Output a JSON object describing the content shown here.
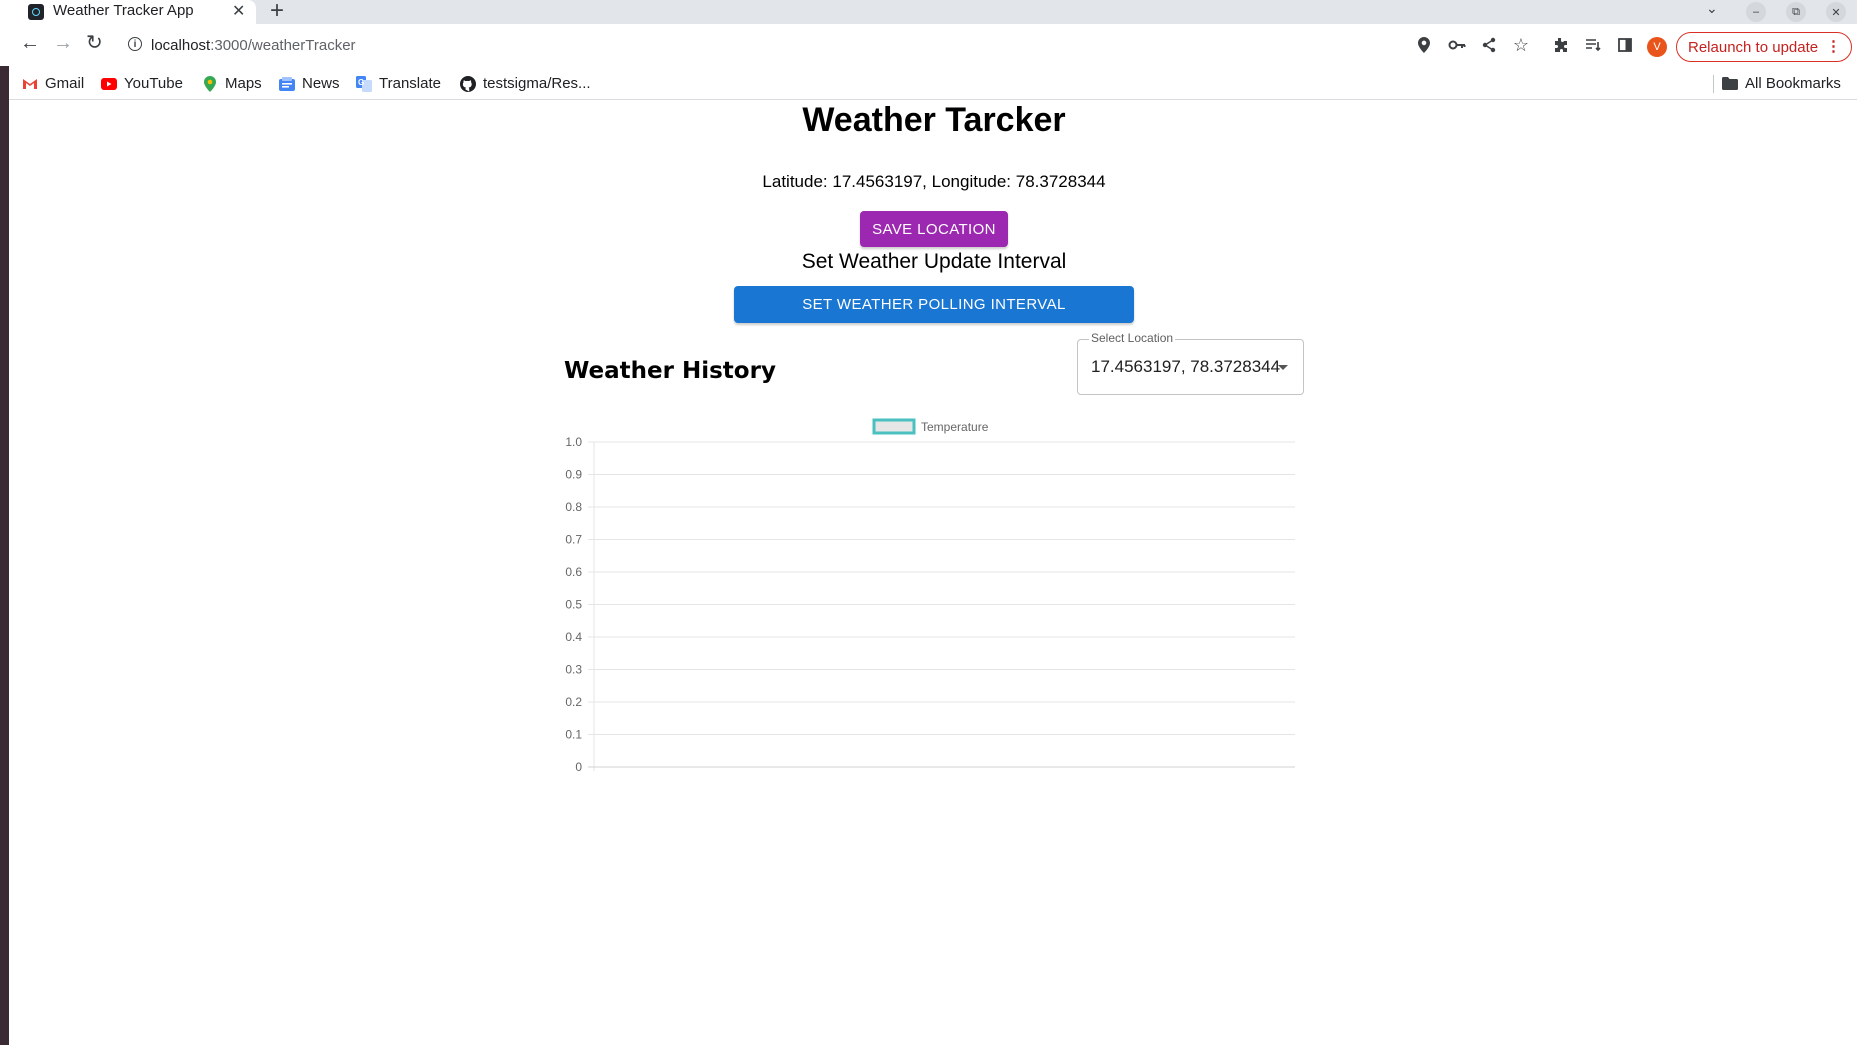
{
  "browser": {
    "tab_title": "Weather Tracker App",
    "tab_close": "✕",
    "new_tab": "+",
    "url_host": "localhost",
    "url_path": ":3000/weatherTracker",
    "avatar_letter": "V",
    "relaunch_label": "Relaunch to update",
    "bookmarks": [
      "Gmail",
      "YouTube",
      "Maps",
      "News",
      "Translate",
      "testsigma/Res..."
    ],
    "all_bookmarks": "All Bookmarks"
  },
  "page": {
    "title": "Weather Tarcker",
    "coordinates": "Latitude: 17.4563197, Longitude: 78.3728344",
    "save_location_label": "SAVE LOCATION",
    "interval_heading": "Set Weather Update Interval",
    "interval_button_label": "SET WEATHER POLLING INTERVAL",
    "history_title": "Weather History",
    "select_label": "Select Location",
    "select_value": "17.4563197, 78.3728344"
  },
  "colors": {
    "save_button": "#9c27b0",
    "interval_button": "#1976d2",
    "series_border": "#4bc0c0",
    "relaunch": "#c5221f"
  },
  "chart_data": {
    "type": "line",
    "legend": [
      "Temperature"
    ],
    "legend_position": "top",
    "series": [
      {
        "name": "Temperature",
        "values": []
      }
    ],
    "x": [],
    "ylim": [
      0,
      1
    ],
    "yticks": [
      "1.0",
      "0.9",
      "0.8",
      "0.7",
      "0.6",
      "0.5",
      "0.4",
      "0.3",
      "0.2",
      "0.1",
      "0"
    ],
    "grid": true
  }
}
